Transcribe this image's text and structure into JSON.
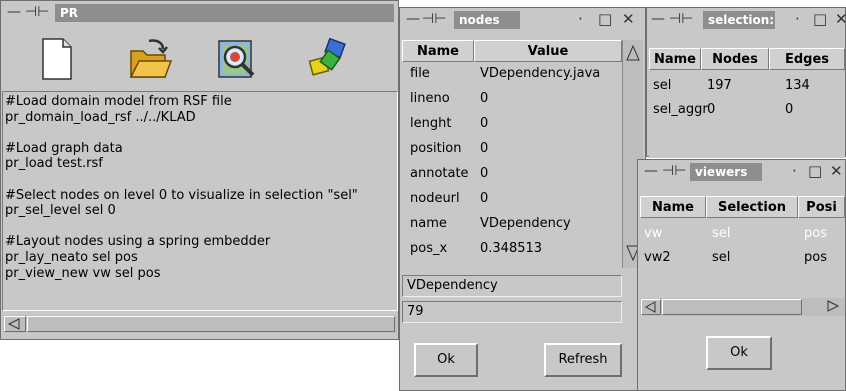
{
  "pr_window": {
    "title": "PR",
    "toolbar_icons": [
      "new-file-icon",
      "open-folder-icon",
      "search-graph-icon",
      "layout-shapes-icon"
    ],
    "script_lines": [
      "#Load domain model from RSF file",
      "pr_domain_load_rsf ../../KLAD",
      "",
      "#Load graph data",
      "pr_load test.rsf",
      "",
      "#Select nodes on level 0 to visualize in selection \"sel\"",
      "pr_sel_level sel 0",
      "",
      "#Layout nodes using a spring embedder",
      "pr_lay_neato sel pos",
      "pr_view_new vw sel pos"
    ]
  },
  "nodes_window": {
    "title": "nodes",
    "col_name": "Name",
    "col_value": "Value",
    "rows": [
      {
        "name": "file",
        "value": "VDependency.java"
      },
      {
        "name": "lineno",
        "value": "0"
      },
      {
        "name": "lenght",
        "value": "0"
      },
      {
        "name": "position",
        "value": "0"
      },
      {
        "name": "annotate",
        "value": "0"
      },
      {
        "name": "nodeurl",
        "value": "0"
      },
      {
        "name": "name",
        "value": "VDependency"
      },
      {
        "name": "pos_x",
        "value": "0.348513"
      }
    ],
    "field1": "VDependency",
    "field2": "79",
    "ok_label": "Ok",
    "refresh_label": "Refresh"
  },
  "selections_window": {
    "title": "selection:",
    "columns": [
      "Name",
      "Nodes",
      "Edges"
    ],
    "rows": [
      [
        "sel",
        "197",
        "134"
      ],
      [
        "sel_aggr",
        "0",
        "0"
      ]
    ]
  },
  "viewers_window": {
    "title": "viewers",
    "columns": [
      "Name",
      "Selection",
      "Posi"
    ],
    "rows": [
      [
        "vw",
        "sel",
        "pos"
      ],
      [
        "vw2",
        "sel",
        "pos"
      ]
    ],
    "ok_label": "Ok"
  },
  "titlebar_glyphs": {
    "minimize": "—",
    "pin": "⊣⊢",
    "dot": "·",
    "maximize": "□",
    "close": "✕"
  }
}
